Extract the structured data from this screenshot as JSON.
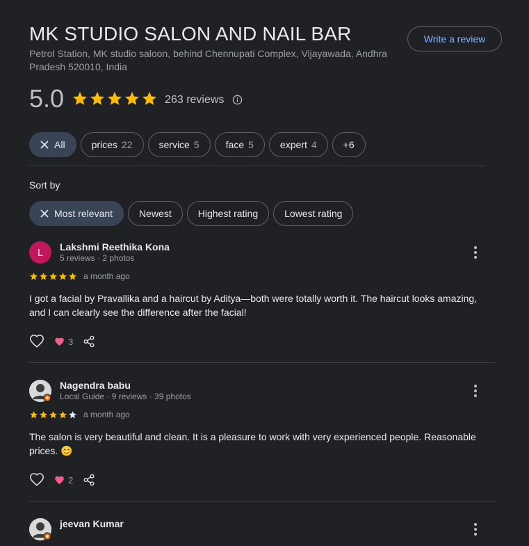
{
  "business": {
    "name": "MK STUDIO SALON AND NAIL BAR",
    "address": "Petrol Station, MK studio saloon, behind Chennupati Complex, Vijayawada, Andhra Pradesh 520010, India",
    "write_review_label": "Write a review",
    "rating": "5.0",
    "rating_stars": 5,
    "review_count": "263 reviews"
  },
  "filters": [
    {
      "label": "All",
      "count": "",
      "active": true
    },
    {
      "label": "prices",
      "count": "22"
    },
    {
      "label": "service",
      "count": "5"
    },
    {
      "label": "face",
      "count": "5"
    },
    {
      "label": "expert",
      "count": "4"
    },
    {
      "label": "+6",
      "count": ""
    }
  ],
  "sort": {
    "label": "Sort by",
    "options": [
      "Most relevant",
      "Newest",
      "Highest rating",
      "Lowest rating"
    ],
    "selected": "Most relevant"
  },
  "reviews": [
    {
      "author": "Lakshmi Reethika Kona",
      "initial": "L",
      "avatar_color": "#c2185b",
      "meta": "5 reviews · 2 photos",
      "stars": 5,
      "time": "a month ago",
      "text": "I got a facial by Pravallika and a haircut by Aditya—both were totally worth it. The haircut looks amazing, and I can clearly see the difference after the facial!",
      "likes": "3"
    },
    {
      "author": "Nagendra babu",
      "initial": "",
      "avatar_color": "#e8eaed",
      "meta": "Local Guide · 9 reviews · 39 photos",
      "stars": 4,
      "time": "a month ago",
      "text": "The salon is very beautiful and clean. It is a pleasure to work with very experienced people. Reasonable prices. 😊",
      "likes": "2"
    },
    {
      "author": "jeevan Kumar",
      "initial": "",
      "avatar_color": "#e8eaed",
      "meta": "",
      "stars": 0,
      "time": "",
      "text": "",
      "likes": ""
    }
  ],
  "colors": {
    "star": "#fbbc04",
    "star_empty": "#e8eaed",
    "heart": "#f25c8a",
    "link": "#8ab4f8"
  }
}
